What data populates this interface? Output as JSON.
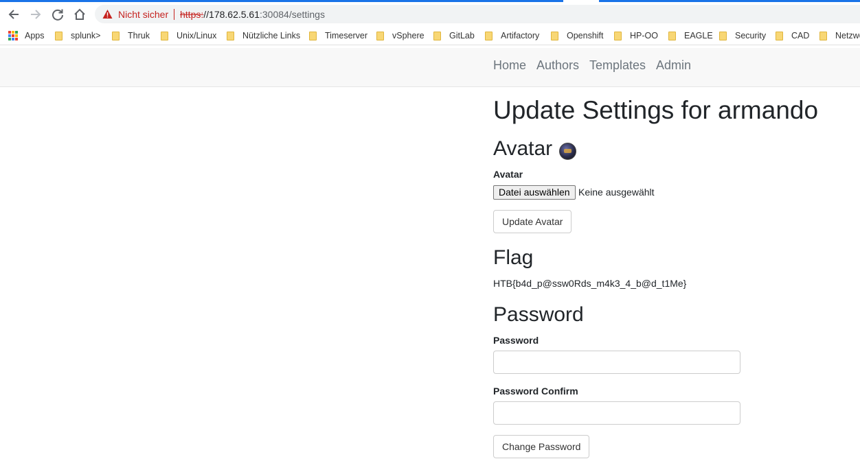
{
  "browser": {
    "security_label": "Nicht sicher",
    "url_scheme": "https:",
    "url_host": "//178.62.5.61",
    "url_rest": ":30084/settings"
  },
  "bookmarks": [
    {
      "label": "Apps",
      "icon": "apps-grid-icon"
    },
    {
      "label": "splunk>",
      "icon": "folder-icon"
    },
    {
      "label": "Thruk",
      "icon": "folder-icon"
    },
    {
      "label": "Unix/Linux",
      "icon": "folder-icon"
    },
    {
      "label": "Nützliche Links",
      "icon": "folder-icon"
    },
    {
      "label": "Timeserver",
      "icon": "folder-icon"
    },
    {
      "label": "vSphere",
      "icon": "folder-icon"
    },
    {
      "label": "GitLab",
      "icon": "folder-icon"
    },
    {
      "label": "Artifactory",
      "icon": "folder-icon"
    },
    {
      "label": "Openshift",
      "icon": "folder-icon"
    },
    {
      "label": "HP-OO",
      "icon": "folder-icon"
    },
    {
      "label": "EAGLE",
      "icon": "folder-icon"
    },
    {
      "label": "Security",
      "icon": "folder-icon"
    },
    {
      "label": "CAD",
      "icon": "folder-icon"
    },
    {
      "label": "Netzwe",
      "icon": "folder-icon"
    }
  ],
  "nav": {
    "items": [
      "Home",
      "Authors",
      "Templates",
      "Admin"
    ]
  },
  "page": {
    "title": "Update Settings for armando",
    "avatar_heading": "Avatar",
    "avatar_label": "Avatar",
    "file_button": "Datei auswählen",
    "file_status": "Keine ausgewählt",
    "update_avatar_button": "Update Avatar",
    "flag_heading": "Flag",
    "flag_value": "HTB{b4d_p@ssw0Rds_m4k3_4_b@d_t1Me}",
    "password_heading": "Password",
    "password_label": "Password",
    "password_value": "",
    "password_confirm_label": "Password Confirm",
    "password_confirm_value": "",
    "change_password_button": "Change Password"
  },
  "colors": {
    "accent": "#1a73e8",
    "warning": "#c5221f",
    "nav_text": "#6c757d",
    "navbar_bg": "#f8f8f8"
  }
}
